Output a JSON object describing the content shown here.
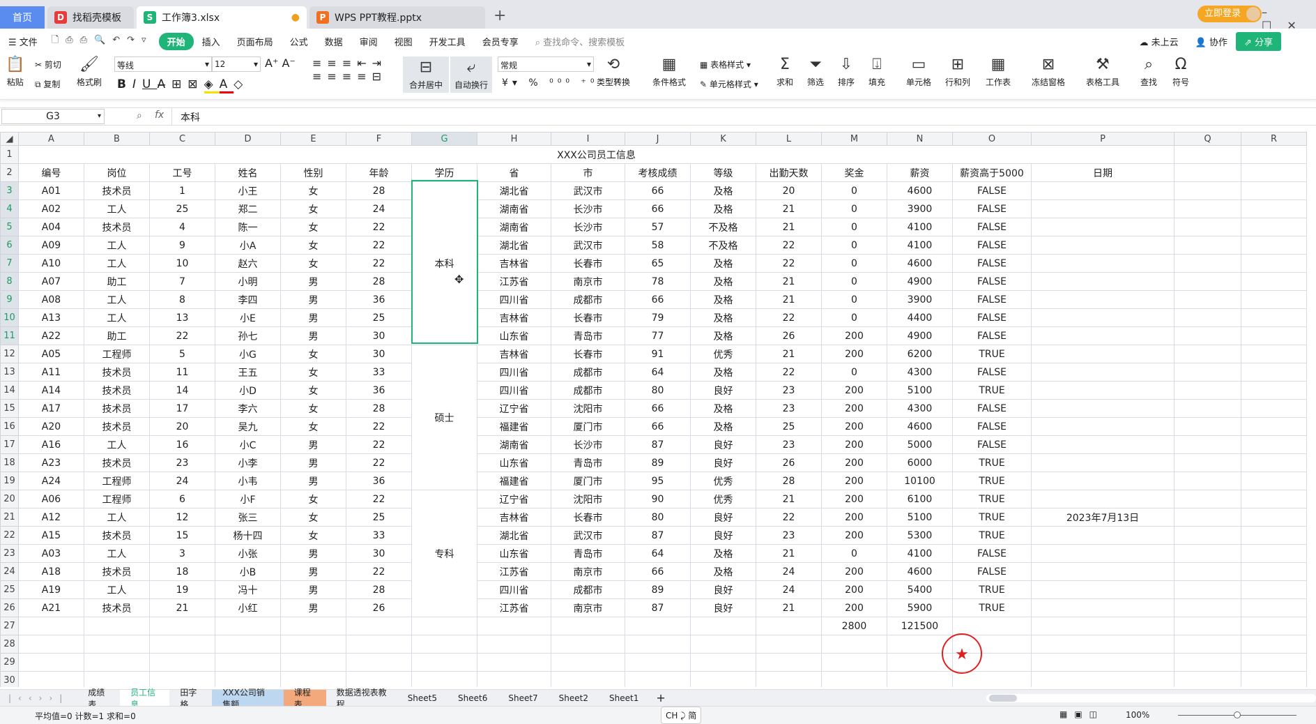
{
  "window": {
    "tabs": [
      {
        "label": "首页"
      },
      {
        "label": "找稻壳模板"
      },
      {
        "label": "工作簿3.xlsx"
      },
      {
        "label": "WPS PPT教程.pptx"
      }
    ],
    "login": "立即登录"
  },
  "menu": {
    "items": [
      "文件",
      "开始",
      "插入",
      "页面布局",
      "公式",
      "数据",
      "审阅",
      "视图",
      "开发工具",
      "会员专享"
    ],
    "search_placeholder": "查找命令、搜索模板",
    "cloud": "未上云",
    "collab": "协作",
    "share": "分享"
  },
  "ribbon": {
    "paste": "粘贴",
    "cut": "剪切",
    "copy": "复制",
    "format_painter": "格式刷",
    "font": "等线",
    "font_size": "12",
    "merge": "合并居中",
    "wrap": "自动换行",
    "number_format": "常规",
    "type_convert": "类型转换",
    "cond_format": "条件格式",
    "table_style": "表格样式",
    "cell_style": "单元格样式",
    "sum": "求和",
    "filter": "筛选",
    "sort": "排序",
    "fill": "填充",
    "cell": "单元格",
    "rowcol": "行和列",
    "worksheet": "工作表",
    "freeze": "冻结窗格",
    "table_tools": "表格工具",
    "find": "查找",
    "symbol": "符号"
  },
  "formula_bar": {
    "name_box": "G3",
    "fx": "fx",
    "value": "本科"
  },
  "columns": [
    "A",
    "B",
    "C",
    "D",
    "E",
    "F",
    "G",
    "H",
    "I",
    "J",
    "K",
    "L",
    "M",
    "N",
    "O",
    "P",
    "Q",
    "R"
  ],
  "sheet": {
    "title": "XXX公司员工信息",
    "headers": [
      "编号",
      "岗位",
      "工号",
      "姓名",
      "性别",
      "年龄",
      "学历",
      "省",
      "市",
      "考核成绩",
      "等级",
      "出勤天数",
      "奖金",
      "薪资",
      "薪资高于5000",
      "日期"
    ],
    "education": [
      {
        "label": "本科",
        "rows": 9
      },
      {
        "label": "硕士",
        "rows": 8
      },
      {
        "label": "专科",
        "rows": 7
      }
    ],
    "rows": [
      [
        "A01",
        "技术员",
        "1",
        "小王",
        "女",
        "28",
        "湖北省",
        "武汉市",
        "66",
        "及格",
        "20",
        "0",
        "4600",
        "FALSE",
        ""
      ],
      [
        "A02",
        "工人",
        "25",
        "郑二",
        "女",
        "24",
        "湖南省",
        "长沙市",
        "66",
        "及格",
        "21",
        "0",
        "3900",
        "FALSE",
        ""
      ],
      [
        "A04",
        "技术员",
        "4",
        "陈一",
        "女",
        "22",
        "湖南省",
        "长沙市",
        "57",
        "不及格",
        "21",
        "0",
        "4100",
        "FALSE",
        ""
      ],
      [
        "A09",
        "工人",
        "9",
        "小A",
        "女",
        "22",
        "湖北省",
        "武汉市",
        "58",
        "不及格",
        "22",
        "0",
        "4100",
        "FALSE",
        ""
      ],
      [
        "A10",
        "工人",
        "10",
        "赵六",
        "女",
        "22",
        "吉林省",
        "长春市",
        "65",
        "及格",
        "22",
        "0",
        "4600",
        "FALSE",
        ""
      ],
      [
        "A07",
        "助工",
        "7",
        "小明",
        "男",
        "28",
        "江苏省",
        "南京市",
        "78",
        "及格",
        "21",
        "0",
        "4900",
        "FALSE",
        ""
      ],
      [
        "A08",
        "工人",
        "8",
        "李四",
        "男",
        "36",
        "四川省",
        "成都市",
        "66",
        "及格",
        "21",
        "0",
        "3900",
        "FALSE",
        ""
      ],
      [
        "A13",
        "工人",
        "13",
        "小E",
        "男",
        "25",
        "吉林省",
        "长春市",
        "79",
        "及格",
        "22",
        "0",
        "4400",
        "FALSE",
        ""
      ],
      [
        "A22",
        "助工",
        "22",
        "孙七",
        "男",
        "30",
        "山东省",
        "青岛市",
        "77",
        "及格",
        "26",
        "200",
        "4900",
        "FALSE",
        ""
      ],
      [
        "A05",
        "工程师",
        "5",
        "小G",
        "女",
        "30",
        "吉林省",
        "长春市",
        "91",
        "优秀",
        "21",
        "200",
        "6200",
        "TRUE",
        ""
      ],
      [
        "A11",
        "技术员",
        "11",
        "王五",
        "女",
        "33",
        "四川省",
        "成都市",
        "64",
        "及格",
        "22",
        "0",
        "4300",
        "FALSE",
        ""
      ],
      [
        "A14",
        "技术员",
        "14",
        "小D",
        "女",
        "36",
        "四川省",
        "成都市",
        "80",
        "良好",
        "23",
        "200",
        "5100",
        "TRUE",
        ""
      ],
      [
        "A17",
        "技术员",
        "17",
        "李六",
        "女",
        "28",
        "辽宁省",
        "沈阳市",
        "66",
        "及格",
        "23",
        "200",
        "4300",
        "FALSE",
        ""
      ],
      [
        "A20",
        "技术员",
        "20",
        "吴九",
        "女",
        "22",
        "福建省",
        "厦门市",
        "66",
        "及格",
        "25",
        "200",
        "4600",
        "FALSE",
        ""
      ],
      [
        "A16",
        "工人",
        "16",
        "小C",
        "男",
        "22",
        "湖南省",
        "长沙市",
        "87",
        "良好",
        "23",
        "200",
        "5000",
        "FALSE",
        ""
      ],
      [
        "A23",
        "技术员",
        "23",
        "小李",
        "男",
        "22",
        "山东省",
        "青岛市",
        "89",
        "良好",
        "26",
        "200",
        "6000",
        "TRUE",
        ""
      ],
      [
        "A24",
        "工程师",
        "24",
        "小韦",
        "男",
        "36",
        "福建省",
        "厦门市",
        "95",
        "优秀",
        "28",
        "200",
        "10100",
        "TRUE",
        ""
      ],
      [
        "A06",
        "工程师",
        "6",
        "小F",
        "女",
        "22",
        "辽宁省",
        "沈阳市",
        "90",
        "优秀",
        "21",
        "200",
        "6100",
        "TRUE",
        ""
      ],
      [
        "A12",
        "工人",
        "12",
        "张三",
        "女",
        "25",
        "吉林省",
        "长春市",
        "80",
        "良好",
        "22",
        "200",
        "5100",
        "TRUE",
        "2023年7月13日"
      ],
      [
        "A15",
        "技术员",
        "15",
        "杨十四",
        "女",
        "33",
        "湖北省",
        "武汉市",
        "87",
        "良好",
        "23",
        "200",
        "5300",
        "TRUE",
        ""
      ],
      [
        "A03",
        "工人",
        "3",
        "小张",
        "男",
        "30",
        "山东省",
        "青岛市",
        "64",
        "及格",
        "21",
        "0",
        "4100",
        "FALSE",
        ""
      ],
      [
        "A18",
        "技术员",
        "18",
        "小B",
        "男",
        "22",
        "江苏省",
        "南京市",
        "66",
        "及格",
        "24",
        "200",
        "4600",
        "FALSE",
        ""
      ],
      [
        "A19",
        "工人",
        "19",
        "冯十",
        "男",
        "28",
        "四川省",
        "成都市",
        "89",
        "良好",
        "24",
        "200",
        "5400",
        "TRUE",
        ""
      ],
      [
        "A21",
        "技术员",
        "21",
        "小红",
        "男",
        "26",
        "江苏省",
        "南京市",
        "87",
        "良好",
        "21",
        "200",
        "5900",
        "TRUE",
        ""
      ]
    ],
    "totals": {
      "bonus": "2800",
      "salary": "121500"
    }
  },
  "sheet_tabs": [
    "成绩表",
    "员工信息",
    "田字格",
    "XXX公司销售额",
    "课程表",
    "数据透视表教程",
    "Sheet5",
    "Sheet6",
    "Sheet7",
    "Sheet2",
    "Sheet1"
  ],
  "active_sheet": "员工信息",
  "status": {
    "summary": "平均值=0  计数=1  求和=0",
    "ime": "CH ⤸ 简",
    "zoom": "100%"
  },
  "colors": {
    "accent": "#1fb578",
    "selection": "#1fb578",
    "stamp": "#e02020"
  }
}
